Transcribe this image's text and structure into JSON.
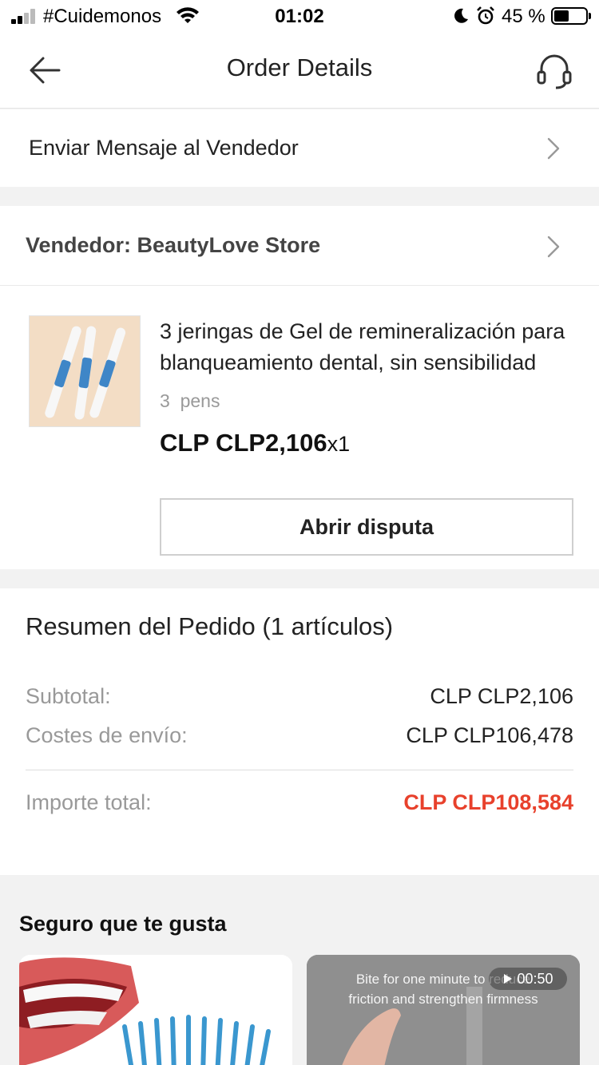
{
  "status_bar": {
    "carrier": "#Cuidemonos",
    "time": "01:02",
    "battery_percent": "45 %",
    "battery_level": 0.45,
    "icons": [
      "signal-icon",
      "wifi-icon",
      "moon-icon",
      "alarm-icon",
      "battery-icon"
    ]
  },
  "nav": {
    "title": "Order Details",
    "back_icon": "arrow-left-icon",
    "support_icon": "headset-icon"
  },
  "message_row": {
    "label": "Enviar Mensaje al Vendedor"
  },
  "seller": {
    "label": "Vendedor: BeautyLove Store"
  },
  "product": {
    "title": "3 jeringas de Gel de remineralización para blanqueamiento dental, sin sensibilidad",
    "variant": "3  pens",
    "price": "CLP CLP2,106",
    "quantity": "x1",
    "dispute_button": "Abrir disputa"
  },
  "summary": {
    "title": "Resumen del Pedido (1 artículos)",
    "rows": [
      {
        "label": "Subtotal:",
        "value": "CLP CLP2,106"
      },
      {
        "label": "Costes de envío:",
        "value": "CLP CLP106,478"
      }
    ],
    "total_label": "Importe total:",
    "total_value": "CLP CLP108,584",
    "total_color": "#e8412c"
  },
  "recommendations": {
    "title": "Seguro que te gusta",
    "cards": [
      {
        "caption_lines": []
      },
      {
        "caption_lines": [
          "Bite for one minute to reduce",
          "friction and strengthen firmness"
        ],
        "video_duration": "00:50"
      }
    ]
  }
}
